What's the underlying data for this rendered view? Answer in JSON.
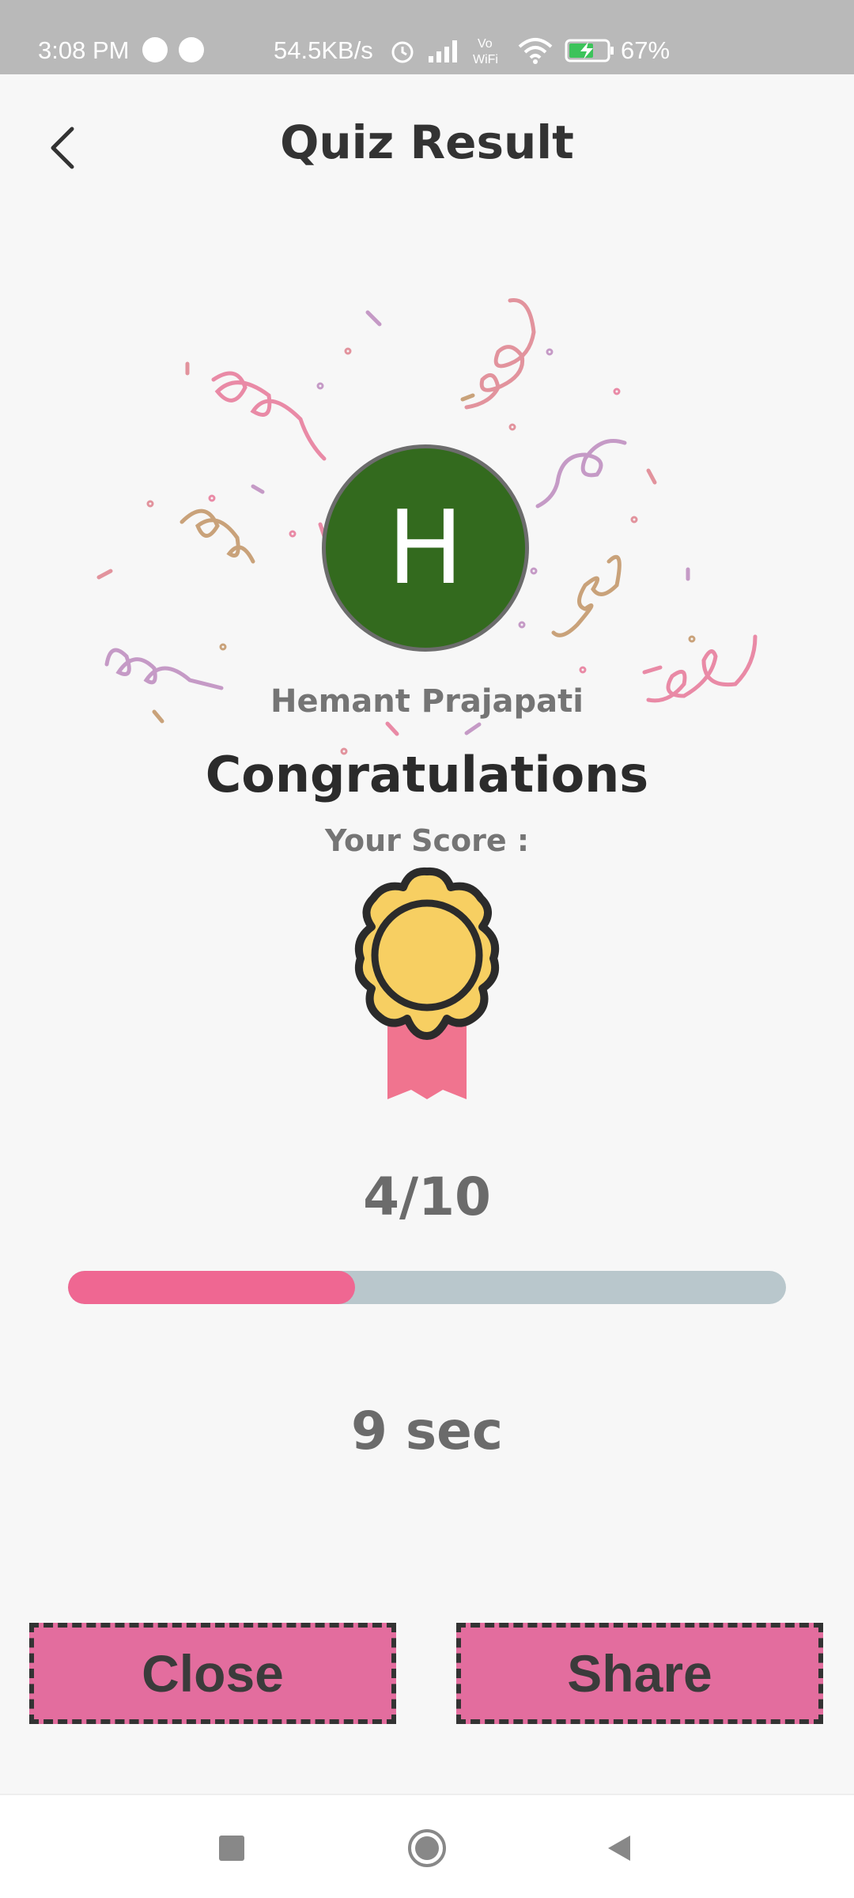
{
  "status_bar": {
    "time": "3:08 PM",
    "network_speed": "54.5KB/s",
    "battery_percent": "67%",
    "icons": [
      "app-notification-icon",
      "app-notification-icon",
      "alarm-icon",
      "signal-icon",
      "vowifi-icon",
      "wifi-icon",
      "battery-charging-icon"
    ]
  },
  "header": {
    "title": "Quiz Result",
    "back_icon": "chevron-left-icon"
  },
  "result": {
    "avatar_initial": "H",
    "avatar_color": "#336a1e",
    "user_name": "Hemant Prajapati",
    "headline": "Congratulations",
    "score_label": "Your Score :",
    "score_text": "4/10",
    "score_correct": 4,
    "score_total": 10,
    "progress_fraction": 0.4,
    "time_text": "9 sec"
  },
  "actions": {
    "close_label": "Close",
    "share_label": "Share"
  },
  "colors": {
    "progress_fill": "#ef6792",
    "progress_track": "#b9c7cc",
    "button_bg": "#e36d9e",
    "medal_gold": "#f7cf62",
    "ribbon": "#f0748f"
  },
  "nav_bar": {
    "icons": [
      "square-recents-icon",
      "circle-home-icon",
      "triangle-back-icon"
    ]
  }
}
